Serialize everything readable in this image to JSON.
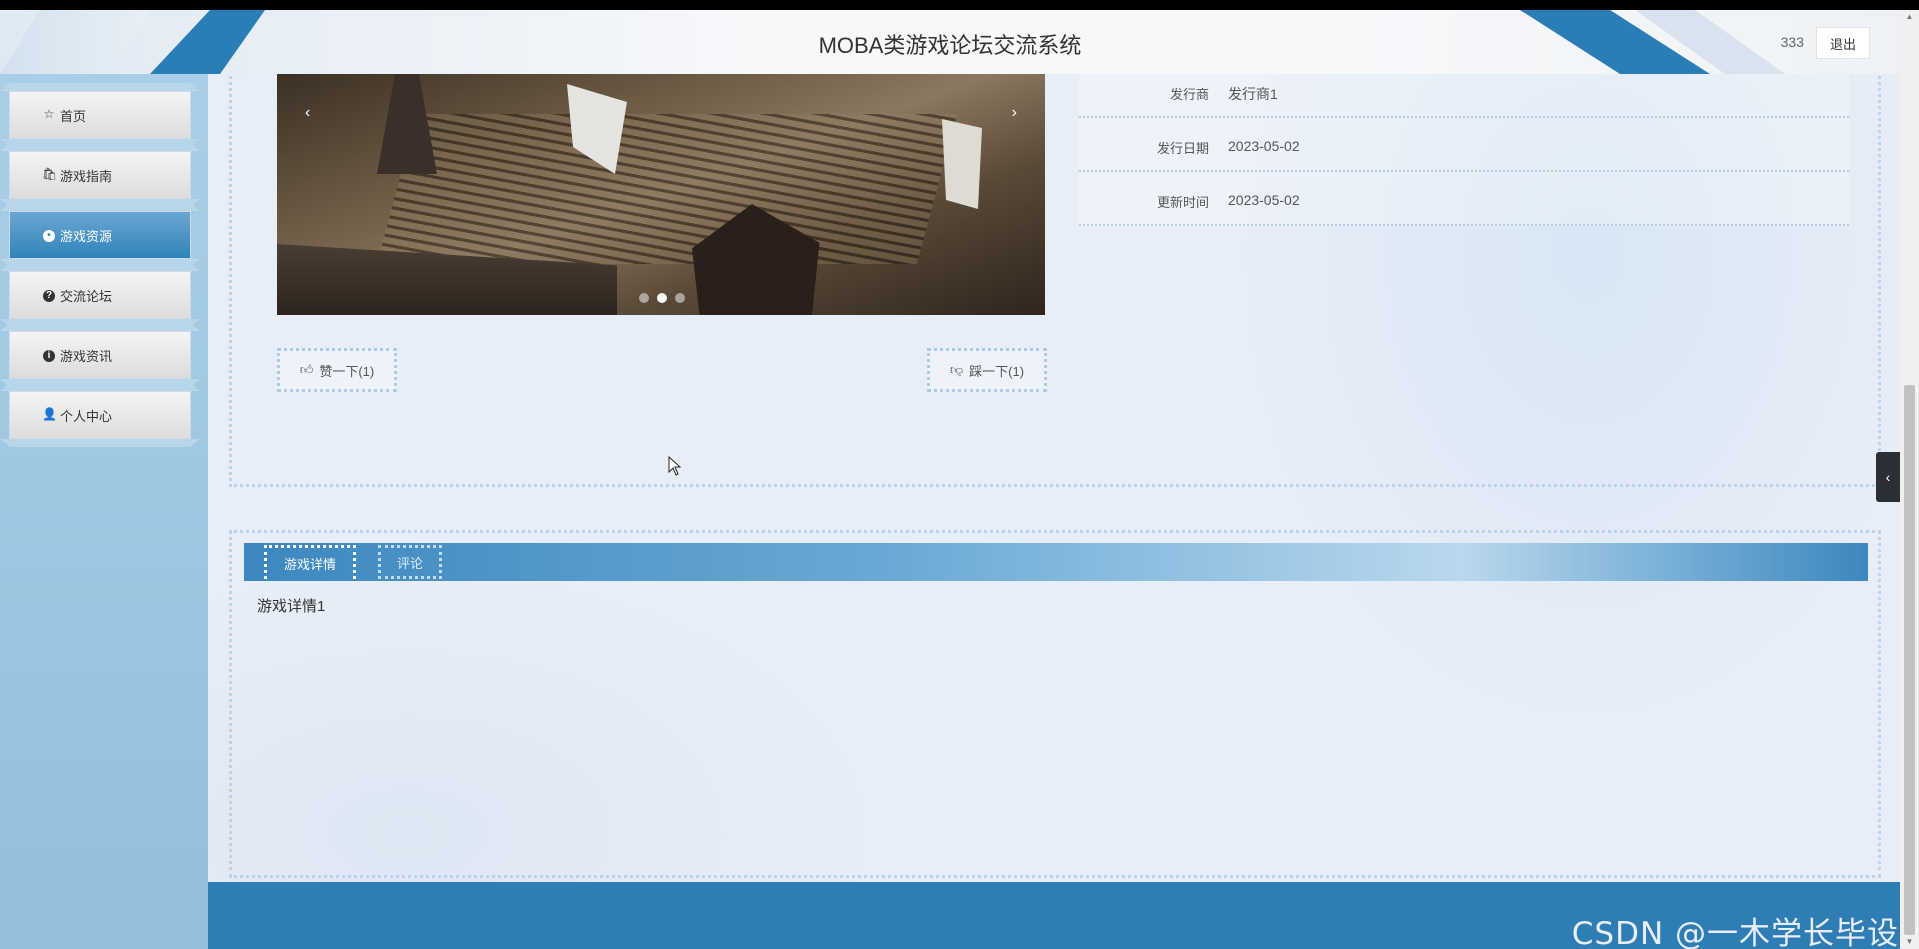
{
  "header": {
    "title": "MOBA类游戏论坛交流系统",
    "user_name": "333",
    "logout_label": "退出"
  },
  "sidebar": {
    "items": [
      {
        "label": "首页",
        "icon": "star-icon",
        "active": false
      },
      {
        "label": "游戏指南",
        "icon": "bag-icon",
        "active": false
      },
      {
        "label": "游戏资源",
        "icon": "circle-icon",
        "active": true
      },
      {
        "label": "交流论坛",
        "icon": "question-icon",
        "active": false
      },
      {
        "label": "游戏资讯",
        "icon": "info-icon",
        "active": false
      },
      {
        "label": "个人中心",
        "icon": "user-icon",
        "active": false
      }
    ]
  },
  "carousel": {
    "prev": "‹",
    "next": "›",
    "dots": 3,
    "active_dot": 2
  },
  "votes": {
    "like_label": "赞一下(1)",
    "dislike_label": "踩一下(1)"
  },
  "info": [
    {
      "key": "发行商",
      "value": "发行商1"
    },
    {
      "key": "发行日期",
      "value": "2023-05-02"
    },
    {
      "key": "更新时间",
      "value": "2023-05-02"
    }
  ],
  "tabs": {
    "detail_label": "游戏详情",
    "comment_label": "评论",
    "content": "游戏详情1"
  },
  "watermark": "CSDN @一木学长毕设",
  "colors": {
    "accent": "#2f7db5",
    "sidebar_bg": "#93bfdc",
    "main_bg": "#e8eef7"
  }
}
